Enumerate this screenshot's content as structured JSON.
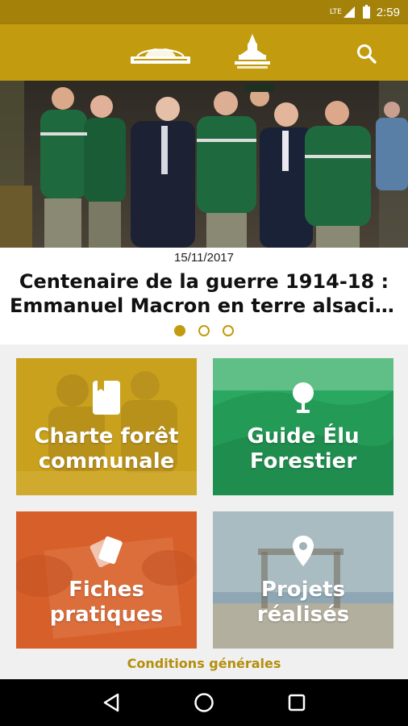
{
  "status_bar": {
    "network": "LTE",
    "time": "2:59",
    "icons": [
      "signal-icon",
      "battery-icon"
    ]
  },
  "app_bar": {
    "logos": [
      "onf-logo",
      "communes-forestieres-logo"
    ],
    "search_icon": "search-icon"
  },
  "slider": {
    "date": "15/11/2017",
    "title_line1": "Centenaire de la guerre 1914-18 :",
    "title_line2": "Emmanuel Macron en terre alsacie…",
    "page_count": 3,
    "active_page": 1
  },
  "tiles": [
    {
      "line1": "Charte forêt",
      "line2": "communale",
      "icon": "bookmark-icon",
      "color": "#c9a11d"
    },
    {
      "line1": "Guide Élu",
      "line2": "Forestier",
      "icon": "tree-icon",
      "color": "#2aa760"
    },
    {
      "line1": "Fiches",
      "line2": "pratiques",
      "icon": "cards-icon",
      "color": "#d75f2a"
    },
    {
      "line1": "Projets",
      "line2": "réalisés",
      "icon": "location-pin-icon",
      "color": "#9fb2b8"
    }
  ],
  "footer": {
    "conditions_label": "Conditions générales"
  },
  "colors": {
    "status_bar": "#a4820a",
    "app_bar": "#c29b0e",
    "accent": "#b58e0c"
  },
  "nav_bar": {
    "icons": [
      "back-icon",
      "home-icon",
      "recents-icon"
    ]
  }
}
